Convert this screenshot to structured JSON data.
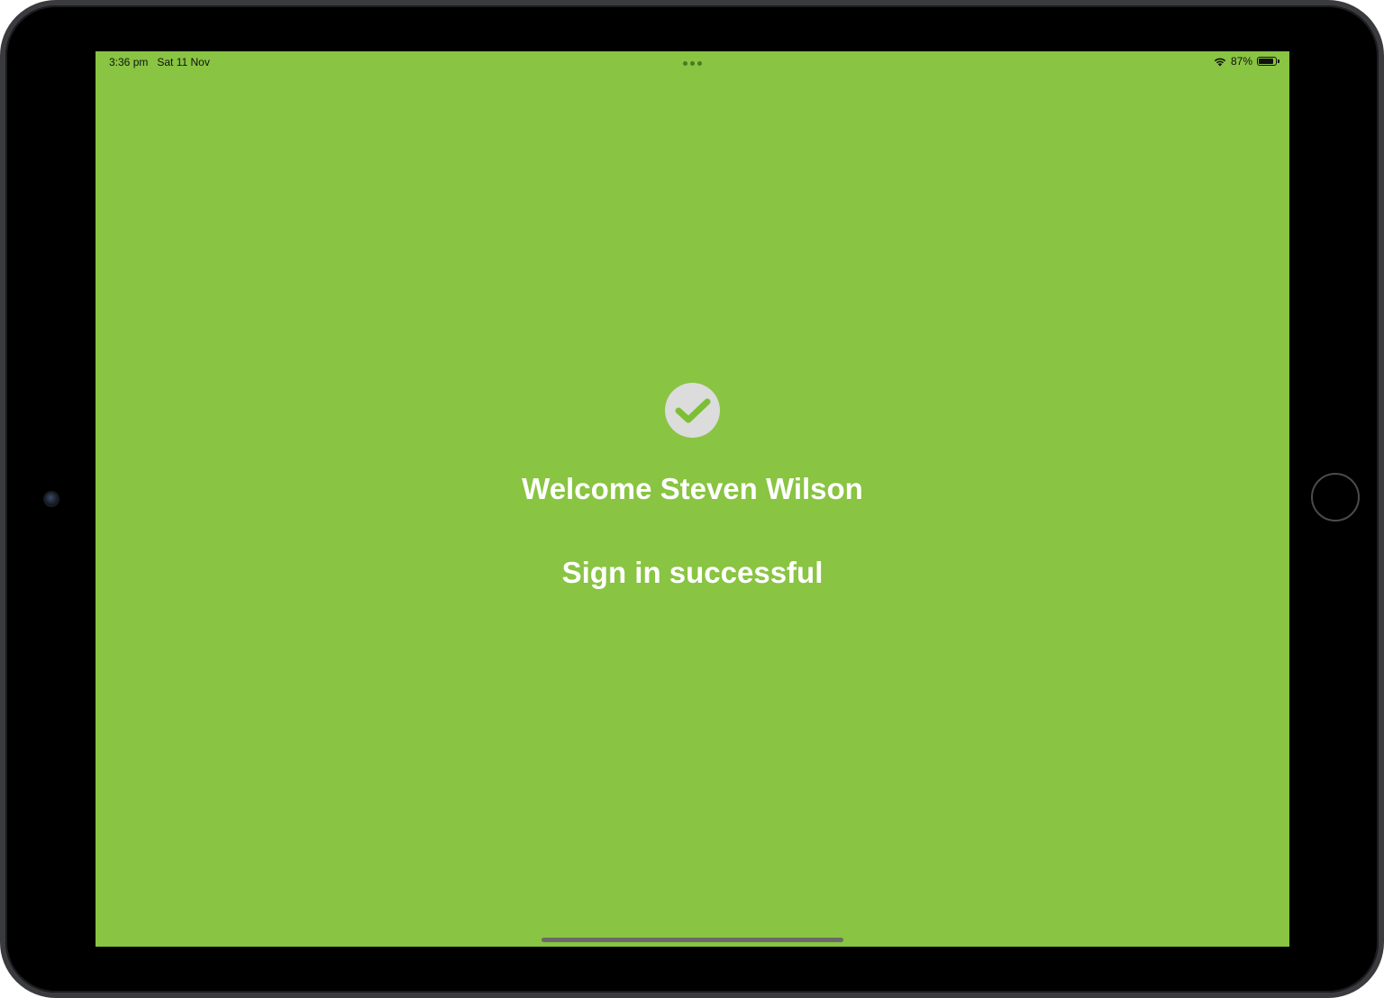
{
  "status_bar": {
    "time": "3:36 pm",
    "date": "Sat 11 Nov",
    "battery_percent_label": "87%",
    "battery_level": 0.87,
    "wifi_icon": "wifi-icon",
    "battery_icon": "battery-icon"
  },
  "main": {
    "icon": "checkmark-circle-icon",
    "welcome_text": "Welcome Steven Wilson",
    "status_text": "Sign in successful"
  },
  "colors": {
    "background": "#89c442",
    "check_circle": "#dcdcdc",
    "checkmark": "#7cbf34",
    "text": "#ffffff"
  }
}
